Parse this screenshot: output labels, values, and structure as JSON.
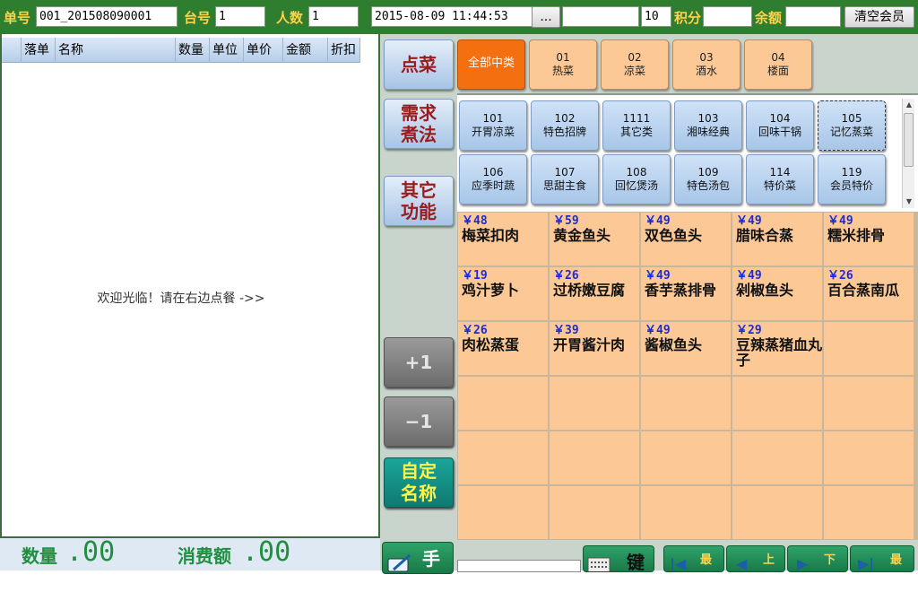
{
  "topbar": {
    "order_no_label": "单号",
    "order_no_value": "001_201508090001",
    "table_label": "台号",
    "table_value": "1",
    "guests_label": "人数",
    "guests_value": "1",
    "datetime_value": "2015-08-09 11:44:53",
    "ellipsis_btn": "...",
    "member_value": "",
    "count_value": "10",
    "points_label": "积分",
    "points_value": "",
    "balance_label": "余额",
    "balance_value": "",
    "clear_member_btn": "清空会员"
  },
  "order_table": {
    "columns": [
      "落单",
      "名称",
      "数量",
      "单位",
      "单价",
      "金额",
      "折扣"
    ],
    "rows": [],
    "welcome": "欢迎光临！请在右边点餐 ->>"
  },
  "summary": {
    "qty_label": "数量",
    "qty_value": ".00",
    "amount_label": "消费额",
    "amount_value": ".00"
  },
  "functions": {
    "order": "点菜",
    "cooking": [
      "需求",
      "煮法"
    ],
    "other": [
      "其它",
      "功能"
    ],
    "plus_one": "+1",
    "minus_one": "−1",
    "custom_name": [
      "自定",
      "名称"
    ],
    "hand_label": "手"
  },
  "categories": [
    {
      "code": "",
      "name": "全部中类",
      "active": true
    },
    {
      "code": "01",
      "name": "热菜",
      "active": false
    },
    {
      "code": "02",
      "name": "凉菜",
      "active": false
    },
    {
      "code": "03",
      "name": "酒水",
      "active": false
    },
    {
      "code": "04",
      "name": "楼面",
      "active": false
    }
  ],
  "subcategories": [
    {
      "code": "101",
      "name": "开胃凉菜"
    },
    {
      "code": "102",
      "name": "特色招牌"
    },
    {
      "code": "1111",
      "name": "其它类"
    },
    {
      "code": "103",
      "name": "湘味经典"
    },
    {
      "code": "104",
      "name": "回味干锅"
    },
    {
      "code": "105",
      "name": "记忆蒸菜"
    },
    {
      "code": "106",
      "name": "应季时蔬"
    },
    {
      "code": "107",
      "name": "思甜主食"
    },
    {
      "code": "108",
      "name": "回忆煲汤"
    },
    {
      "code": "109",
      "name": "特色汤包"
    },
    {
      "code": "114",
      "name": "特价菜"
    },
    {
      "code": "119",
      "name": "会员特价"
    }
  ],
  "dishes": [
    {
      "price": "￥48",
      "name": "梅菜扣肉"
    },
    {
      "price": "￥59",
      "name": "黄金鱼头"
    },
    {
      "price": "￥49",
      "name": "双色鱼头"
    },
    {
      "price": "￥49",
      "name": "腊味合蒸"
    },
    {
      "price": "￥49",
      "name": "糯米排骨"
    },
    {
      "price": "￥19",
      "name": "鸡汁萝卜"
    },
    {
      "price": "￥26",
      "name": "过桥嫩豆腐"
    },
    {
      "price": "￥49",
      "name": "香芋蒸排骨"
    },
    {
      "price": "￥49",
      "name": "剁椒鱼头"
    },
    {
      "price": "￥26",
      "name": "百合蒸南瓜"
    },
    {
      "price": "￥26",
      "name": "肉松蒸蛋"
    },
    {
      "price": "￥39",
      "name": "开胃酱汁肉"
    },
    {
      "price": "￥49",
      "name": "酱椒鱼头"
    },
    {
      "price": "￥29",
      "name": "豆辣蒸猪血丸子"
    }
  ],
  "bottom": {
    "search_value": "",
    "key_label": "键",
    "first_label": "最",
    "prev_label": "上",
    "next_label": "下",
    "last_label": "最"
  }
}
